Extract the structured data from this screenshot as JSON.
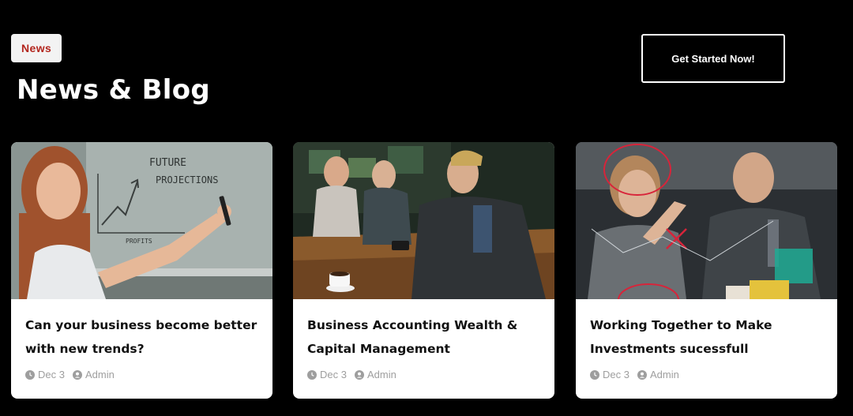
{
  "header": {
    "eyebrow": "News",
    "title": "News & Blog",
    "cta_label": "Get Started Now!"
  },
  "posts": [
    {
      "title": "Can your business become better with new trends?",
      "date": "Dec 3",
      "author": "Admin",
      "image": "Woman presenting a whiteboard chart with the handwritten text 'Future Projections' and 'Profits'",
      "image_text_1": "FUTURE",
      "image_text_2": "PROJECTIONS",
      "image_text_3": "PROFITS"
    },
    {
      "title": "Business Accounting Wealth & Capital Management",
      "date": "Dec 3",
      "author": "Admin",
      "image": "Team meeting around a wooden table with coffee cups and phones"
    },
    {
      "title": "Working Together to Make Investments sucessfull",
      "date": "Dec 3",
      "author": "Admin",
      "image": "Business people drawing red circles and a chart on a glass board"
    }
  ],
  "icons": {
    "date": "clock-icon",
    "author": "user-icon"
  },
  "colors": {
    "background": "#000000",
    "eyebrow_text": "#b3261e",
    "card_background": "#ffffff",
    "meta_text": "#9e9e9e"
  }
}
